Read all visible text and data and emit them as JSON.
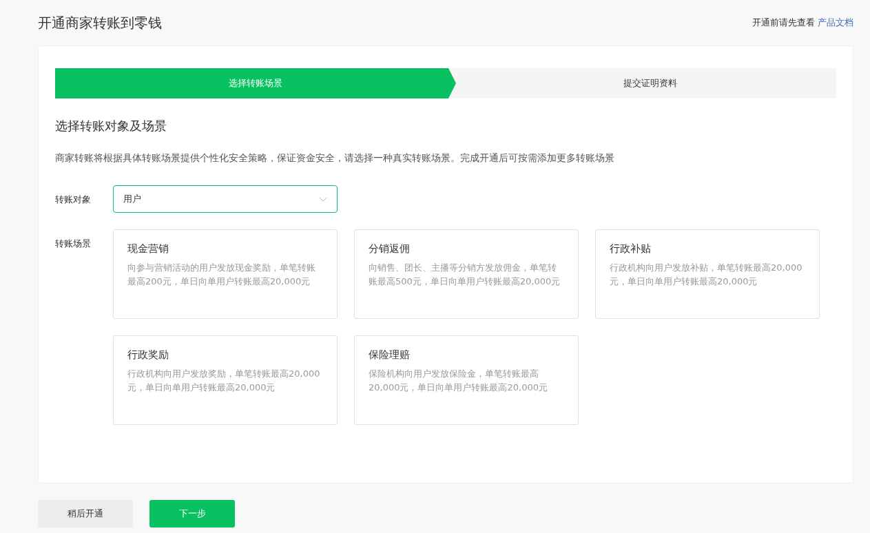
{
  "page": {
    "title": "开通商家转账到零钱",
    "help_text": "开通前请先查看",
    "help_link": "产品文档"
  },
  "steps": [
    {
      "label": "选择转账场景",
      "selected": true
    },
    {
      "label": "提交证明资料",
      "selected": false
    }
  ],
  "section": {
    "title": "选择转账对象及场景",
    "description": "商家转账将根据具体转账场景提供个性化安全策略，保证资金安全，请选择一种真实转账场景。完成开通后可按需添加更多转账场景"
  },
  "target": {
    "label": "转账对象",
    "value": "用户"
  },
  "scenarios": {
    "label": "转账场景",
    "items": [
      {
        "title": "现金营销",
        "description": "向参与营销活动的用户发放现金奖励，单笔转账最高200元，单日向单用户转账最高20,000元"
      },
      {
        "title": "分销返佣",
        "description": "向销售、团长、主播等分销方发放佣金，单笔转账最高500元，单日向单用户转账最高20,000元"
      },
      {
        "title": "行政补贴",
        "description": "行政机构向用户发放补贴，单笔转账最高20,000元，单日向单用户转账最高20,000元"
      },
      {
        "title": "行政奖励",
        "description": "行政机构向用户发放奖励，单笔转账最高20,000元，单日向单用户转账最高20,000元"
      },
      {
        "title": "保险理赔",
        "description": "保险机构向用户发放保险金，单笔转账最高20,000元，单日向单用户转账最高20,000元"
      }
    ]
  },
  "buttons": [
    {
      "label": "稍后开通",
      "kind": "secondary"
    },
    {
      "label": "下一步",
      "kind": "primary"
    }
  ]
}
